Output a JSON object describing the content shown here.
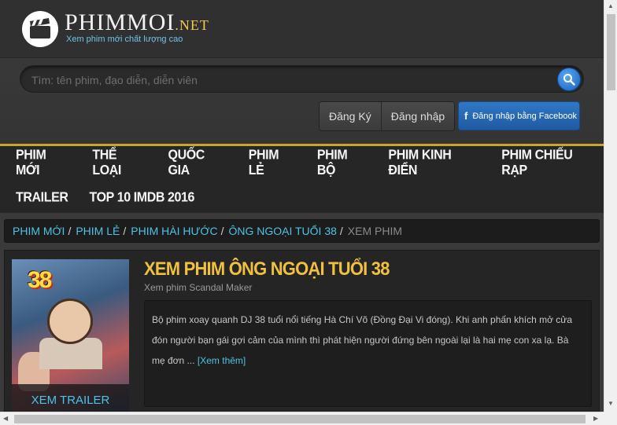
{
  "site": {
    "logo_name": "PHIMMOI",
    "logo_suffix": ".NET",
    "tagline": "Xem phim mới chất lượng cao"
  },
  "search": {
    "placeholder": "Tìm: tên phim, đạo diễn, diễn viên",
    "icon": "search-icon"
  },
  "auth": {
    "register_label": "Đăng Ký",
    "login_label": "Đăng nhập",
    "facebook_label": "Đăng nhập bằng Facebook",
    "facebook_icon": "f"
  },
  "nav": {
    "row1": [
      "PHIM MỚI",
      "THỂ LOẠI",
      "QUỐC GIA",
      "PHIM LẺ",
      "PHIM BỘ",
      "PHIM KINH ĐIỂN",
      "PHIM CHIẾU RẠP"
    ],
    "row2": [
      "TRAILER",
      "TOP 10 IMDB 2016"
    ]
  },
  "breadcrumb": {
    "items": [
      "PHIM MỚI",
      "PHIM LẺ",
      "PHIM HÀI HƯỚC",
      "ÔNG NGOẠI TUỔI 38"
    ],
    "separator": "/",
    "current": "XEM PHIM"
  },
  "movie": {
    "poster_title": "38",
    "trailer_label": "XEM TRAILER",
    "title": "XEM PHIM ÔNG NGOẠI TUỔI 38",
    "subtitle": "Xem phim Scandal Maker",
    "description": "Bộ phim xoay quanh DJ 38 tuổi nổi tiếng Hà Chí Võ (Đồng Đại Vi đóng). Khi anh phấn khích mở cửa đón người bạn gái gợi cảm của mình thì phát hiện người đứng bên ngoài lại là hai mẹ con xa lạ. Bà mẹ đơn ...",
    "more_label": "[Xem thêm]"
  },
  "colors": {
    "accent_gold": "#c9a52a",
    "link_blue": "#4ec3e8",
    "title_yellow": "#f0c040",
    "facebook_blue": "#1f5aa3"
  }
}
